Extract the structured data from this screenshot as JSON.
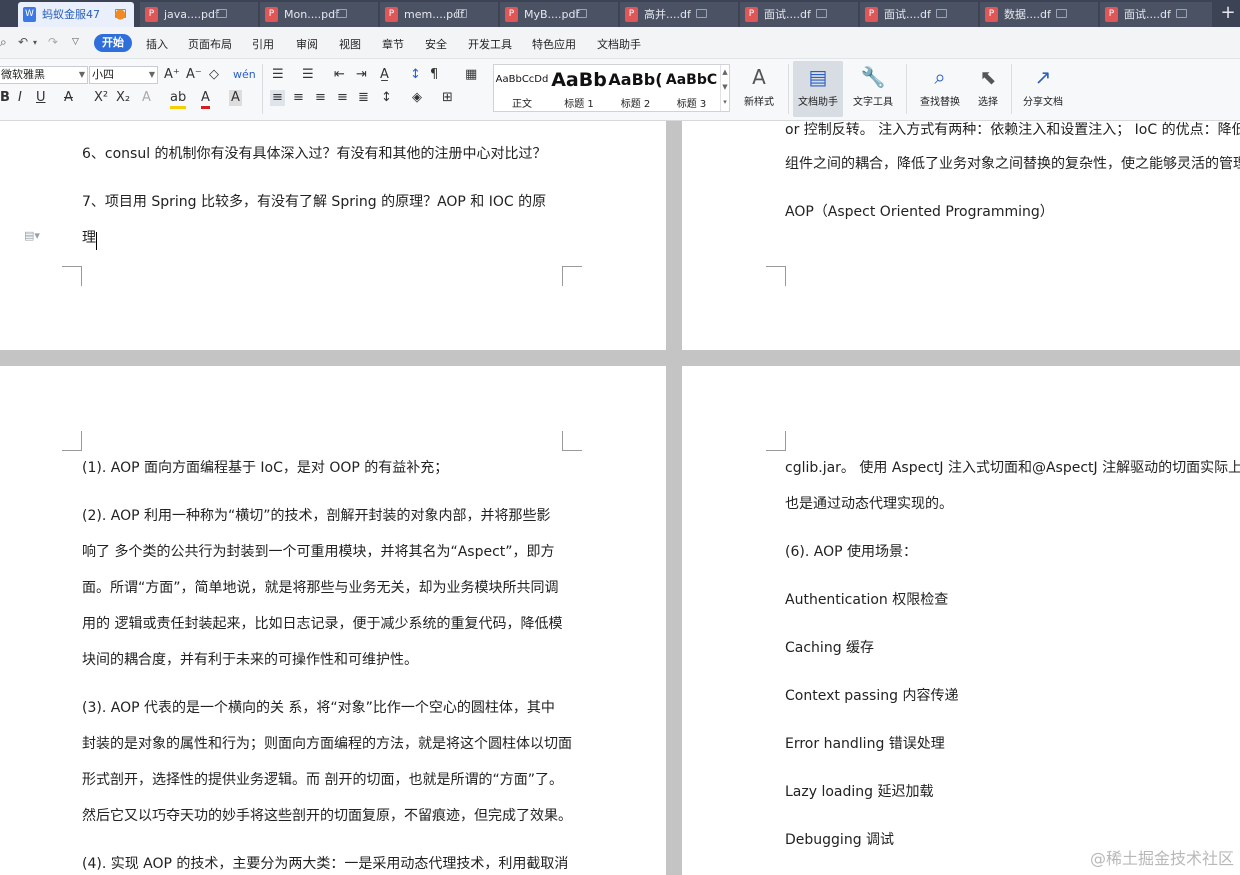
{
  "tabs": [
    {
      "label": "蚂蚁金服47",
      "icon": "wps-writer-icon",
      "active": true,
      "modified": true
    },
    {
      "label": "java....pdf",
      "icon": "pdf-icon"
    },
    {
      "label": "Mon....pdf",
      "icon": "pdf-icon"
    },
    {
      "label": "mem....pdf",
      "icon": "pdf-icon"
    },
    {
      "label": "MyB....pdf",
      "icon": "pdf-icon"
    },
    {
      "label": "高并....df",
      "icon": "pdf-icon"
    },
    {
      "label": "面试....df",
      "icon": "pdf-icon"
    },
    {
      "label": "面试....df",
      "icon": "pdf-icon"
    },
    {
      "label": "数据....df",
      "icon": "pdf-icon"
    },
    {
      "label": "面试....df",
      "icon": "pdf-icon"
    }
  ],
  "new_tab": "+",
  "menu": [
    "开始",
    "插入",
    "页面布局",
    "引用",
    "审阅",
    "视图",
    "章节",
    "安全",
    "开发工具",
    "特色应用",
    "文档助手"
  ],
  "ribbon": {
    "font_name": "微软雅黑",
    "font_size": "小四",
    "styles": [
      {
        "sample": "AaBbCcDd",
        "label": "正文"
      },
      {
        "sample": "AaBb",
        "label": "标题 1"
      },
      {
        "sample": "AaBb(",
        "label": "标题 2"
      },
      {
        "sample": "AaBbC",
        "label": "标题 3"
      }
    ],
    "new_style": "新样式",
    "doc_helper": "文档助手",
    "text_tool": "文字工具",
    "find_replace": "查找替换",
    "select": "选择",
    "share": "分享文档"
  },
  "pages": {
    "left_top": {
      "q6": "6、consul 的机制你有没有具体深入过？有没有和其他的注册中心对比过？",
      "q7_line1": "7、项目用 Spring 比较多，有没有了解 Spring 的原理？AOP 和 IOC 的原",
      "q7_line2": "理"
    },
    "right_top": {
      "line1": "or 控制反转。 注入方式有两种：依赖注入和设置注入； IoC 的优点：降低",
      "line2": "组件之间的耦合，降低了业务对象之间替换的复杂性，使之能够灵活的管理对",
      "line3": "AOP（Aspect Oriented Programming）"
    },
    "left_bottom": {
      "lines": [
        "(1). AOP 面向方面编程基于 IoC，是对 OOP 的有益补充；",
        "(2). AOP 利用一种称为“横切”的技术，剖解开封装的对象内部，并将那些影",
        "响了 多个类的公共行为封装到一个可重用模块，并将其名为“Aspect”，即方",
        "面。所谓“方面”，简单地说，就是将那些与业务无关，却为业务模块所共同调",
        "用的 逻辑或责任封装起来，比如日志记录，便于减少系统的重复代码，降低模",
        "块间的耦合度，并有利于未来的可操作性和可维护性。",
        "(3). AOP 代表的是一个横向的关 系，将“对象”比作一个空心的圆柱体，其中",
        "封装的是对象的属性和行为；则面向方面编程的方法，就是将这个圆柱体以切面",
        "形式剖开，选择性的提供业务逻辑。而 剖开的切面，也就是所谓的“方面”了。",
        "然后它又以巧夺天功的妙手将这些剖开的切面复原，不留痕迹，但完成了效果。",
        "(4). 实现 AOP 的技术，主要分为两大类：一是采用动态代理技术，利用截取消"
      ]
    },
    "right_bottom": {
      "line1": "cglib.jar。  使用 AspectJ 注入式切面和@AspectJ 注解驱动的切面实际上底",
      "line2": "也是通过动态代理实现的。",
      "heading": "(6). AOP 使用场景：",
      "items": [
        "Authentication  权限检查",
        "Caching  缓存",
        "Context passing  内容传递",
        "Error handling  错误处理",
        "Lazy loading   延迟加载",
        "Debugging  调试"
      ]
    }
  },
  "watermark": "@稀土掘金技术社区"
}
